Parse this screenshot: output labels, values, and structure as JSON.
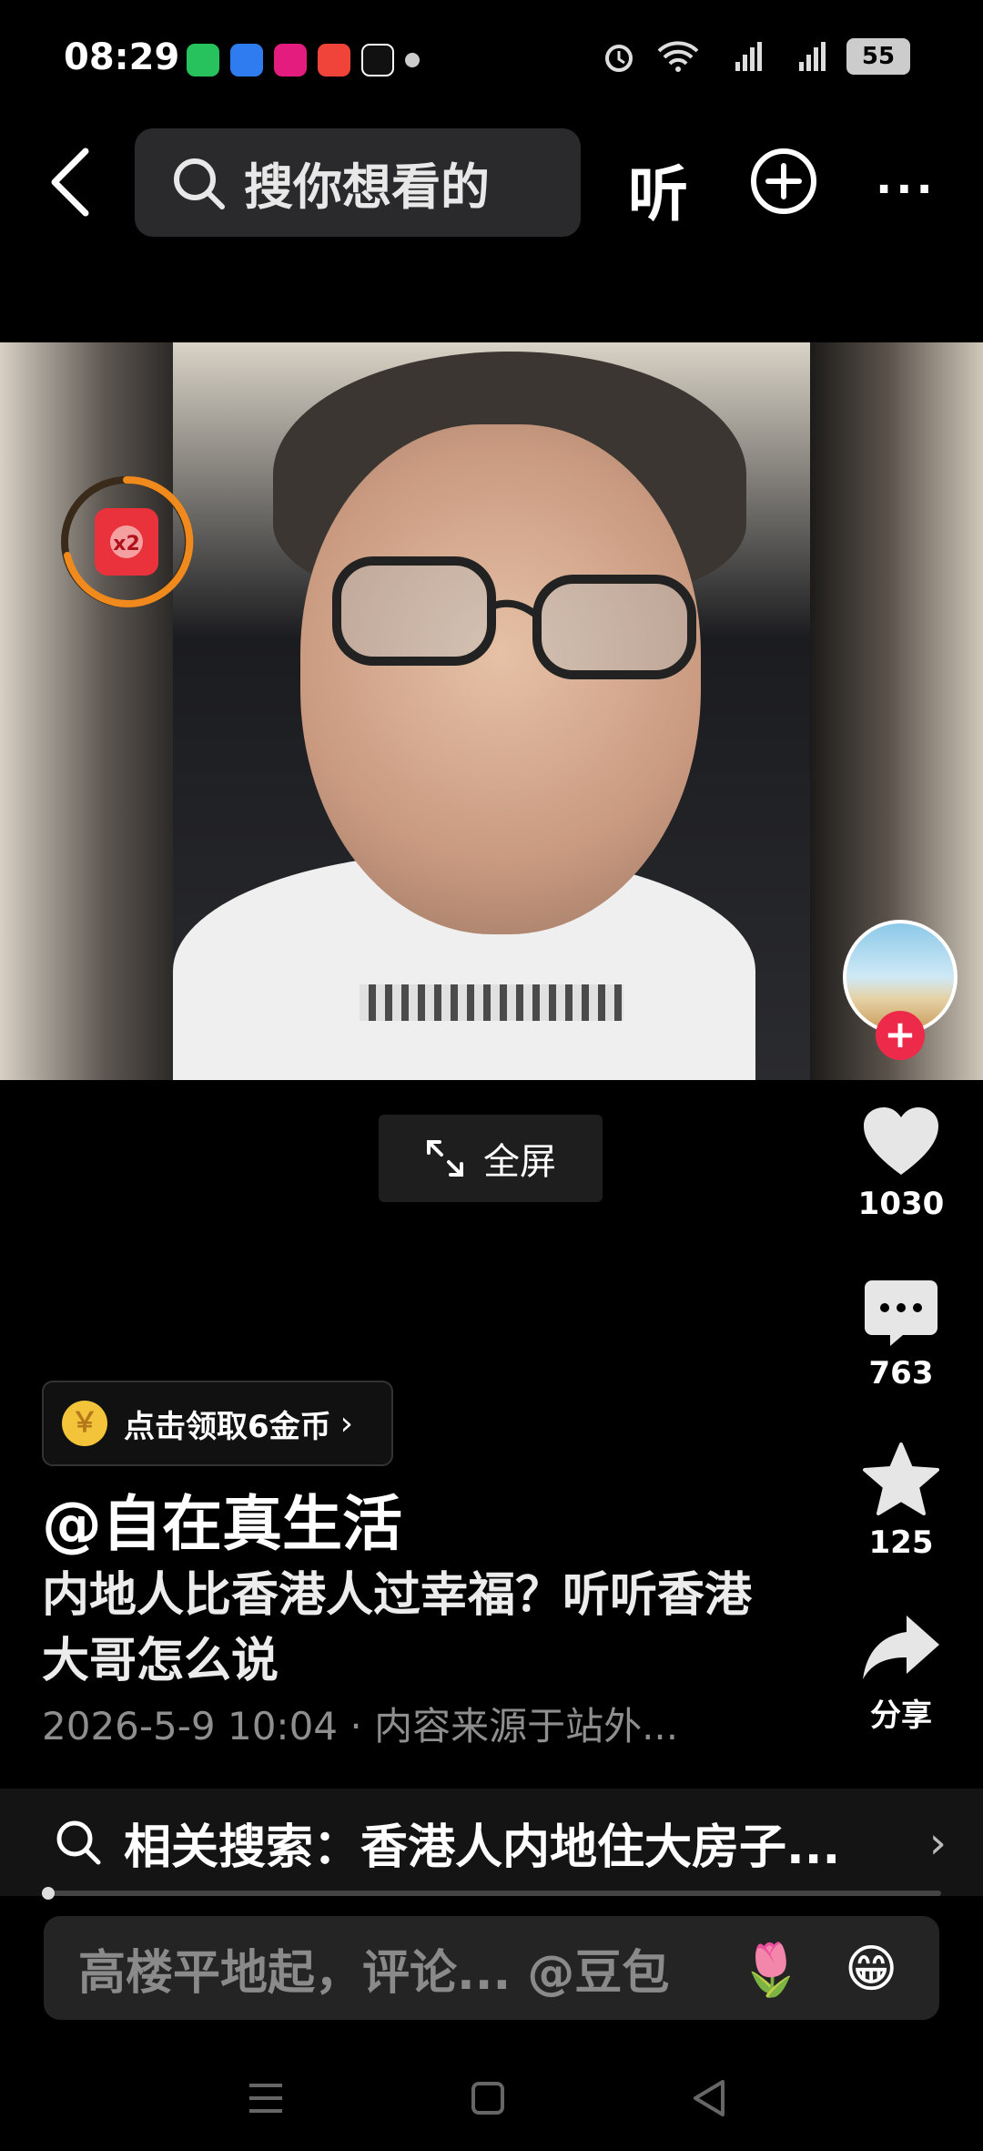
{
  "status_bar": {
    "time": "08:29",
    "battery": "55",
    "apps": [
      "wechat-app",
      "blue-app",
      "store-app",
      "video-app",
      "tiktok-app"
    ],
    "icons": [
      "alarm-icon",
      "wifi-icon",
      "signal-5g-icon",
      "signal-5g-icon"
    ]
  },
  "top_bar": {
    "search_placeholder": "搜你想看的",
    "listen_label": "听"
  },
  "video": {
    "fullscreen_label": "全屏"
  },
  "actions": {
    "like_count": "1030",
    "comment_count": "763",
    "favorite_count": "125",
    "share_label": "分享"
  },
  "reward": {
    "coins_label": "点击领取6金币",
    "coin_glyph": "￥",
    "redpacket_multiplier": "x2"
  },
  "post": {
    "author": "@自在真生活",
    "description": "内地人比香港人过幸福？听听香港大哥怎么说",
    "meta": "2026-5-9 10:04 · 内容来源于站外..."
  },
  "related_search": {
    "label": "相关搜索：香港人内地住大房子..."
  },
  "comment_bar": {
    "placeholder": "高楼平地起，评论... @豆包",
    "emoji_1": "🌷",
    "emoji_2": "😁"
  },
  "colors": {
    "background": "#000000",
    "accent_red": "#ee2a4a",
    "coin_gold": "#f3c43a",
    "redpacket_ring": "#f08a1c"
  }
}
